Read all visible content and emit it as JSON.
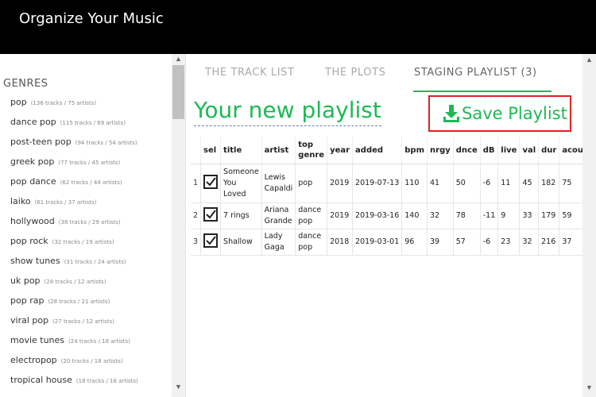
{
  "app": {
    "title": "Organize Your Music"
  },
  "sidebar": {
    "heading": "GENRES",
    "items": [
      {
        "label": "pop",
        "count": "(136 tracks / 75 artists)"
      },
      {
        "label": "dance pop",
        "count": "(115 tracks / 69 artists)"
      },
      {
        "label": "post-teen pop",
        "count": "(94 tracks / 54 artists)"
      },
      {
        "label": "greek pop",
        "count": "(77 tracks / 45 artists)"
      },
      {
        "label": "pop dance",
        "count": "(62 tracks / 44 artists)"
      },
      {
        "label": "laiko",
        "count": "(61 tracks / 37 artists)"
      },
      {
        "label": "hollywood",
        "count": "(38 tracks / 29 artists)"
      },
      {
        "label": "pop rock",
        "count": "(32 tracks / 19 artists)"
      },
      {
        "label": "show tunes",
        "count": "(31 tracks / 24 artists)"
      },
      {
        "label": "uk pop",
        "count": "(28 tracks / 12 artists)"
      },
      {
        "label": "pop rap",
        "count": "(28 tracks / 21 artists)"
      },
      {
        "label": "viral pop",
        "count": "(27 tracks / 12 artists)"
      },
      {
        "label": "movie tunes",
        "count": "(24 tracks / 18 artists)"
      },
      {
        "label": "electropop",
        "count": "(20 tracks / 18 artists)"
      },
      {
        "label": "tropical house",
        "count": "(18 tracks / 16 artists)"
      }
    ]
  },
  "tabs": [
    {
      "label": "THE TRACK LIST"
    },
    {
      "label": "THE PLOTS"
    },
    {
      "label": "STAGING PLAYLIST (3)"
    }
  ],
  "playlist": {
    "title": "Your new playlist",
    "save_label": "Save Playlist"
  },
  "table": {
    "headers": [
      "sel",
      "title",
      "artist",
      "top genre",
      "year",
      "added",
      "bpm",
      "nrgy",
      "dnce",
      "dB",
      "live",
      "val",
      "dur",
      "acou"
    ],
    "rows": [
      {
        "num": "1",
        "title": "Someone You Loved",
        "artist": "Lewis Capaldi",
        "genre": "pop",
        "year": "2019",
        "added": "2019-07-13",
        "bpm": "110",
        "nrgy": "41",
        "dnce": "50",
        "db": "-6",
        "live": "11",
        "val": "45",
        "dur": "182",
        "acou": "75"
      },
      {
        "num": "2",
        "title": "7 rings",
        "artist": "Ariana Grande",
        "genre": "dance pop",
        "year": "2019",
        "added": "2019-03-16",
        "bpm": "140",
        "nrgy": "32",
        "dnce": "78",
        "db": "-11",
        "live": "9",
        "val": "33",
        "dur": "179",
        "acou": "59"
      },
      {
        "num": "3",
        "title": "Shallow",
        "artist": "Lady Gaga",
        "genre": "dance pop",
        "year": "2018",
        "added": "2019-03-01",
        "bpm": "96",
        "nrgy": "39",
        "dnce": "57",
        "db": "-6",
        "live": "23",
        "val": "32",
        "dur": "216",
        "acou": "37"
      }
    ]
  },
  "colors": {
    "accent": "#1db954",
    "highlight_border": "#e32020",
    "topbar": "#000000"
  }
}
